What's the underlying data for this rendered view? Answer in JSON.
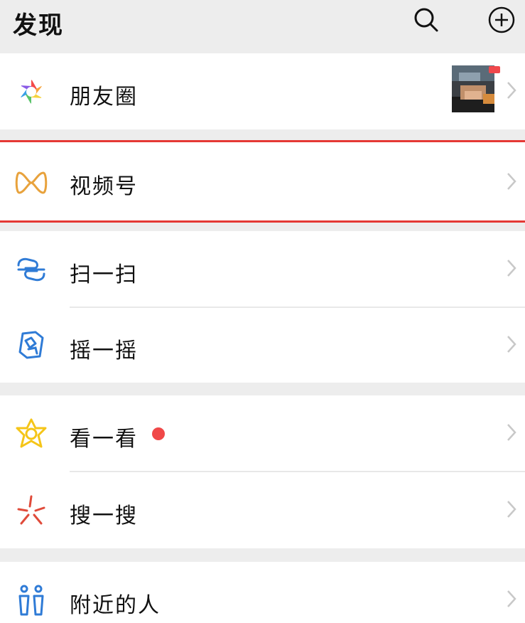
{
  "header": {
    "title": "发现",
    "search_icon": "search-icon",
    "add_icon": "plus-circle-icon"
  },
  "items": {
    "moments": {
      "label": "朋友圈",
      "icon": "moments-aperture-icon",
      "has_thumbnail": true,
      "thumbnail_badge": "red"
    },
    "channels": {
      "label": "视频号",
      "icon": "channels-icon",
      "highlighted": true
    },
    "scan": {
      "label": "扫一扫",
      "icon": "scan-icon"
    },
    "shake": {
      "label": "摇一摇",
      "icon": "shake-icon"
    },
    "top_stories": {
      "label": "看一看",
      "icon": "top-stories-icon",
      "badge": "red-dot"
    },
    "search": {
      "label": "搜一搜",
      "icon": "search-sparkle-icon"
    },
    "nearby": {
      "label": "附近的人",
      "icon": "people-nearby-icon"
    }
  },
  "colors": {
    "background": "#ededed",
    "highlight_border": "#e53935",
    "badge_red": "#f04848",
    "scan_blue": "#2f7bd6",
    "top_stories_yellow": "#f5c518",
    "search_red": "#e04b3a",
    "channels_orange": "#e8a23c"
  }
}
